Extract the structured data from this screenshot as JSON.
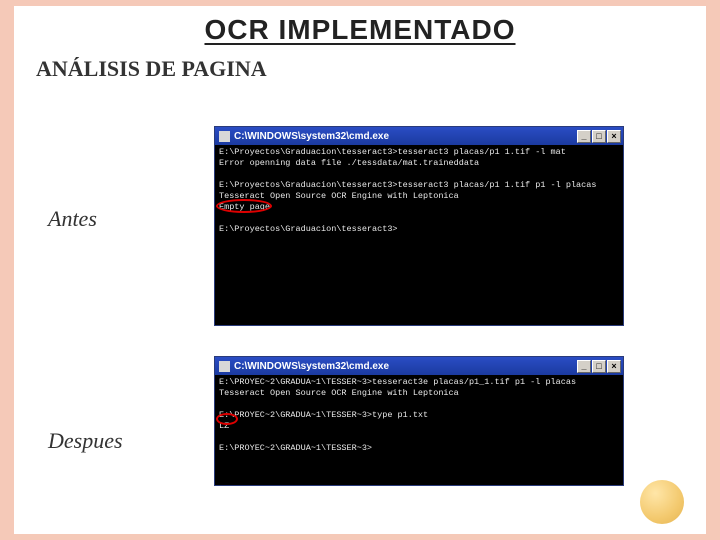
{
  "title": "OCR IMPLEMENTADO",
  "subtitle": "ANÁLISIS DE PAGINA",
  "labels": {
    "antes": "Antes",
    "despues": "Despues"
  },
  "console1": {
    "title": "C:\\WINDOWS\\system32\\cmd.exe",
    "btns": {
      "min": "_",
      "max": "□",
      "close": "×"
    },
    "body": "E:\\Proyectos\\Graduacion\\tesseract3>tesseract3 placas/p1 1.tif -l mat\nError openning data file ./tessdata/mat.traineddata\n\nE:\\Proyectos\\Graduacion\\tesseract3>tesseract3 placas/p1 1.tif p1 -l placas\nTesseract Open Source OCR Engine with Leptonica\nEmpty page\n\nE:\\Proyectos\\Graduacion\\tesseract3>"
  },
  "console2": {
    "title": "C:\\WINDOWS\\system32\\cmd.exe",
    "btns": {
      "min": "_",
      "max": "□",
      "close": "×"
    },
    "body": "E:\\PROYEC~2\\GRADUA~1\\TESSER~3>tesseract3e placas/p1_1.tif p1 -l placas\nTesseract Open Source OCR Engine with Leptonica\n\nE:\\PROYEC~2\\GRADUA~1\\TESSER~3>type p1.txt\nLZ\n\nE:\\PROYEC~2\\GRADUA~1\\TESSER~3>"
  }
}
